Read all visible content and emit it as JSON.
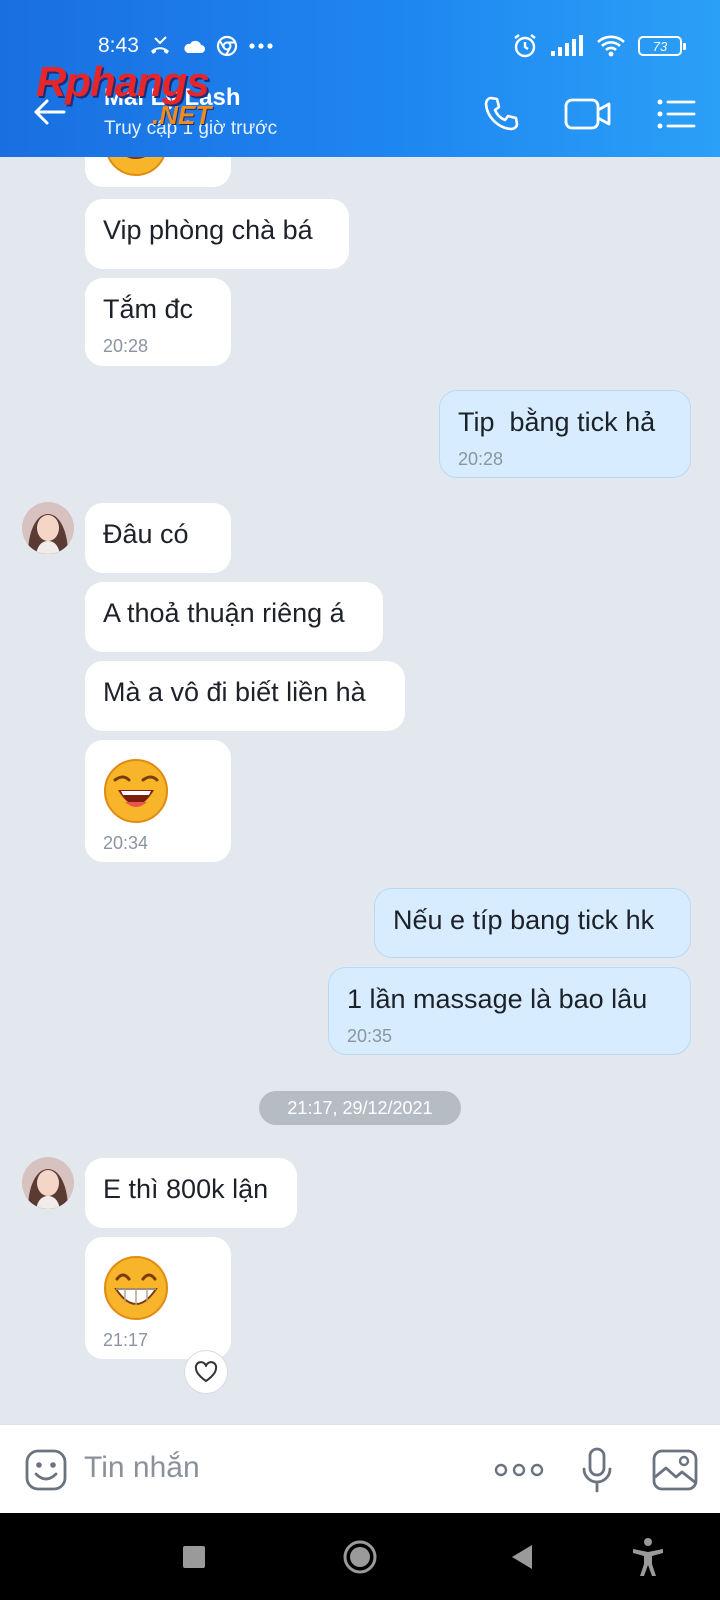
{
  "status_bar": {
    "time": "8:43",
    "battery": "73",
    "icons_left": [
      "missed-call-icon",
      "cloud-icon",
      "chrome-icon",
      "more-dots-icon"
    ],
    "icons_right": [
      "alarm-icon",
      "signal-icon",
      "wifi-icon",
      "battery-icon"
    ]
  },
  "header": {
    "contact_name": "Mai Ly Lash",
    "contact_status": "Truy cập 1 giờ trước",
    "buttons": [
      "back-icon",
      "phone-icon",
      "video-call-icon",
      "menu-list-icon"
    ]
  },
  "watermark": {
    "main": "Rphangs",
    "sub": ".NET"
  },
  "messages": [
    {
      "from": "them",
      "text": "Vip phòng chà bá"
    },
    {
      "from": "them",
      "text": "Tắm đc",
      "time": "20:28"
    },
    {
      "from": "me",
      "text": "Tip  bằng tick hả",
      "time": "20:28"
    },
    {
      "from": "them",
      "text": "Đâu có"
    },
    {
      "from": "them",
      "text": "A thoả thuận riêng á"
    },
    {
      "from": "them",
      "text": "Mà a vô đi biết liền hà"
    },
    {
      "from": "them",
      "emoji": "laughing-emoji",
      "time": "20:34"
    },
    {
      "from": "me",
      "text": "Nếu e típ bang tick hk"
    },
    {
      "from": "me",
      "text": "1 lần massage là bao lâu",
      "time": "20:35"
    },
    {
      "from": "them",
      "text": "E thì 800k lận"
    },
    {
      "from": "them",
      "emoji": "grinning-emoji",
      "time": "21:17"
    }
  ],
  "date_separator": "21:17, 29/12/2021",
  "composer": {
    "placeholder": "Tin nhắn",
    "buttons": [
      "sticker-icon",
      "more-options-icon",
      "microphone-icon",
      "gallery-icon"
    ]
  },
  "colors": {
    "header_gradient_start": "#1a6fe0",
    "header_gradient_end": "#2ba0f7",
    "chat_background": "#e3e8ef",
    "my_bubble": "#d7edff",
    "their_bubble": "#ffffff"
  }
}
